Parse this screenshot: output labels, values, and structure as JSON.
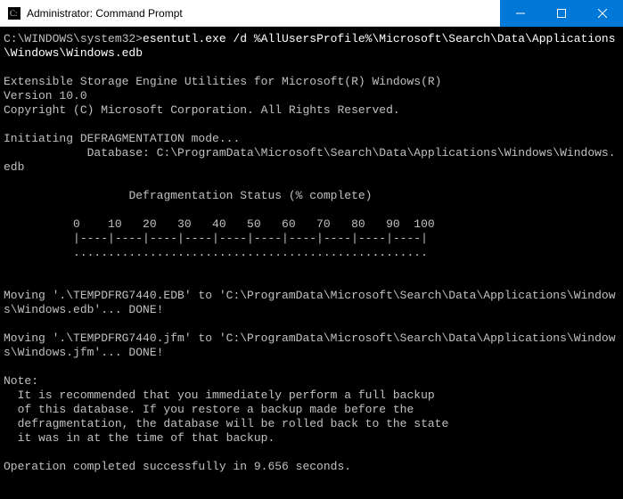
{
  "window": {
    "title": "Administrator: Command Prompt"
  },
  "terminal": {
    "prompt": "C:\\WINDOWS\\system32>",
    "command": "esentutl.exe /d %AllUsersProfile%\\Microsoft\\Search\\Data\\Applications\\Windows\\Windows.edb",
    "blank1": "",
    "header1": "Extensible Storage Engine Utilities for Microsoft(R) Windows(R)",
    "header2": "Version 10.0",
    "header3": "Copyright (C) Microsoft Corporation. All Rights Reserved.",
    "blank2": "",
    "mode": "Initiating DEFRAGMENTATION mode...",
    "dbline": "            Database: C:\\ProgramData\\Microsoft\\Search\\Data\\Applications\\Windows\\Windows.edb",
    "blank3": "",
    "status_title": "                  Defragmentation Status (% complete)",
    "blank4": "",
    "scale": "          0    10   20   30   40   50   60   70   80   90  100",
    "ticks": "          |----|----|----|----|----|----|----|----|----|----|",
    "dots": "          ...................................................",
    "blank5": "",
    "blank6": "",
    "move1": "Moving '.\\TEMPDFRG7440.EDB' to 'C:\\ProgramData\\Microsoft\\Search\\Data\\Applications\\Windows\\Windows.edb'... DONE!",
    "blank7": "",
    "move2": "Moving '.\\TEMPDFRG7440.jfm' to 'C:\\ProgramData\\Microsoft\\Search\\Data\\Applications\\Windows\\Windows.jfm'... DONE!",
    "blank8": "",
    "note_title": "Note:",
    "note1": "  It is recommended that you immediately perform a full backup",
    "note2": "  of this database. If you restore a backup made before the",
    "note3": "  defragmentation, the database will be rolled back to the state",
    "note4": "  it was in at the time of that backup.",
    "blank9": "",
    "completed": "Operation completed successfully in 9.656 seconds."
  }
}
